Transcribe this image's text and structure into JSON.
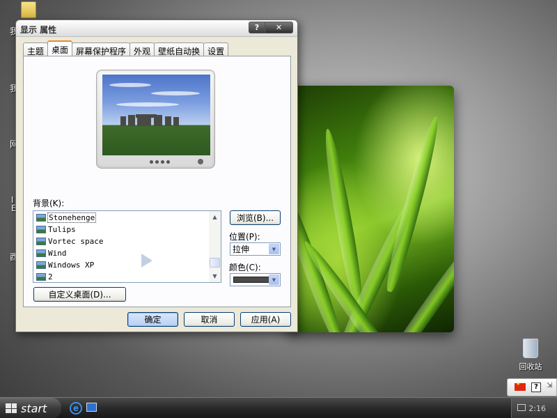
{
  "window": {
    "title": "显示 属性",
    "help_button": "?",
    "close_button": "✕"
  },
  "tabs": [
    {
      "label": "主题"
    },
    {
      "label": "桌面",
      "active": true
    },
    {
      "label": "屏幕保护程序"
    },
    {
      "label": "外观"
    },
    {
      "label": "壁纸自动换"
    },
    {
      "label": "设置"
    }
  ],
  "desktop_tab": {
    "background_label": "背景(K):",
    "backgrounds": [
      {
        "name": "Stonehenge",
        "selected": true
      },
      {
        "name": "Tulips"
      },
      {
        "name": "Vortec space"
      },
      {
        "name": "Wind"
      },
      {
        "name": "Windows XP"
      },
      {
        "name": "2"
      }
    ],
    "browse_button": "浏览(B)...",
    "position_label": "位置(P):",
    "position_value": "拉伸",
    "color_label": "颜色(C):",
    "color_value": "#4a4a4a",
    "customize_button": "自定义桌面(D)..."
  },
  "dialog_buttons": {
    "ok": "确定",
    "cancel": "取消",
    "apply": "应用(A)"
  },
  "desktop": {
    "recycle_bin_label": "回收站",
    "left_fragments": [
      "我",
      "我",
      "网",
      "I",
      "E",
      "酉"
    ]
  },
  "langbar": {
    "help": "?"
  },
  "taskbar": {
    "start_label": "start",
    "clock": "2:16"
  }
}
